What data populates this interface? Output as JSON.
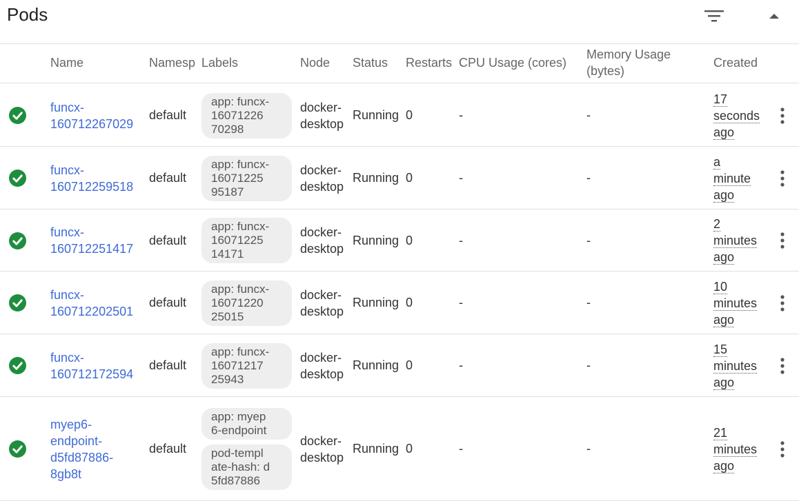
{
  "header": {
    "title": "Pods",
    "filter_icon": "filter-list-icon",
    "collapse_icon": "arrow-up-icon"
  },
  "columns": {
    "name": "Name",
    "namespace": "Namesp",
    "labels": "Labels",
    "node": "Node",
    "status": "Status",
    "restarts": "Restarts",
    "cpu": "CPU Usage (cores)",
    "memory_line1": "Memory Usage",
    "memory_line2": "(bytes)",
    "created": "Created"
  },
  "colors": {
    "link": "#3f6ad8",
    "status_ok": "#1e8e3e",
    "chip_bg": "#eeeeee",
    "divider": "#e0e0e0"
  },
  "rows": [
    {
      "name_lines": [
        "funcx-",
        "160712267029"
      ],
      "namespace": "default",
      "labels": [
        [
          "app: funcx-",
          "16071226",
          "70298"
        ]
      ],
      "node_lines": [
        "docker-",
        "desktop"
      ],
      "status": "Running",
      "restarts": "0",
      "cpu": "-",
      "memory": "-",
      "created_lines": [
        "17",
        "seconds",
        "ago"
      ]
    },
    {
      "name_lines": [
        "funcx-",
        "160712259518"
      ],
      "namespace": "default",
      "labels": [
        [
          "app: funcx-",
          "16071225",
          "95187"
        ]
      ],
      "node_lines": [
        "docker-",
        "desktop"
      ],
      "status": "Running",
      "restarts": "0",
      "cpu": "-",
      "memory": "-",
      "created_lines": [
        "a",
        "minute",
        "ago"
      ]
    },
    {
      "name_lines": [
        "funcx-",
        "160712251417"
      ],
      "namespace": "default",
      "labels": [
        [
          "app: funcx-",
          "16071225",
          "14171"
        ]
      ],
      "node_lines": [
        "docker-",
        "desktop"
      ],
      "status": "Running",
      "restarts": "0",
      "cpu": "-",
      "memory": "-",
      "created_lines": [
        "2",
        "minutes",
        "ago"
      ]
    },
    {
      "name_lines": [
        "funcx-",
        "160712202501"
      ],
      "namespace": "default",
      "labels": [
        [
          "app: funcx-",
          "16071220",
          "25015"
        ]
      ],
      "node_lines": [
        "docker-",
        "desktop"
      ],
      "status": "Running",
      "restarts": "0",
      "cpu": "-",
      "memory": "-",
      "created_lines": [
        "10",
        "minutes",
        "ago"
      ]
    },
    {
      "name_lines": [
        "funcx-",
        "160712172594"
      ],
      "namespace": "default",
      "labels": [
        [
          "app: funcx-",
          "16071217",
          "25943"
        ]
      ],
      "node_lines": [
        "docker-",
        "desktop"
      ],
      "status": "Running",
      "restarts": "0",
      "cpu": "-",
      "memory": "-",
      "created_lines": [
        "15",
        "minutes",
        "ago"
      ]
    },
    {
      "name_lines": [
        "myep6-",
        "endpoint-",
        "d5fd87886-",
        "8gb8t"
      ],
      "namespace": "default",
      "labels": [
        [
          "app: myep",
          "6-endpoint"
        ],
        [
          "pod-templ",
          "ate-hash: d",
          "5fd87886"
        ]
      ],
      "node_lines": [
        "docker-",
        "desktop"
      ],
      "status": "Running",
      "restarts": "0",
      "cpu": "-",
      "memory": "-",
      "created_lines": [
        "21",
        "minutes",
        "ago"
      ]
    }
  ]
}
